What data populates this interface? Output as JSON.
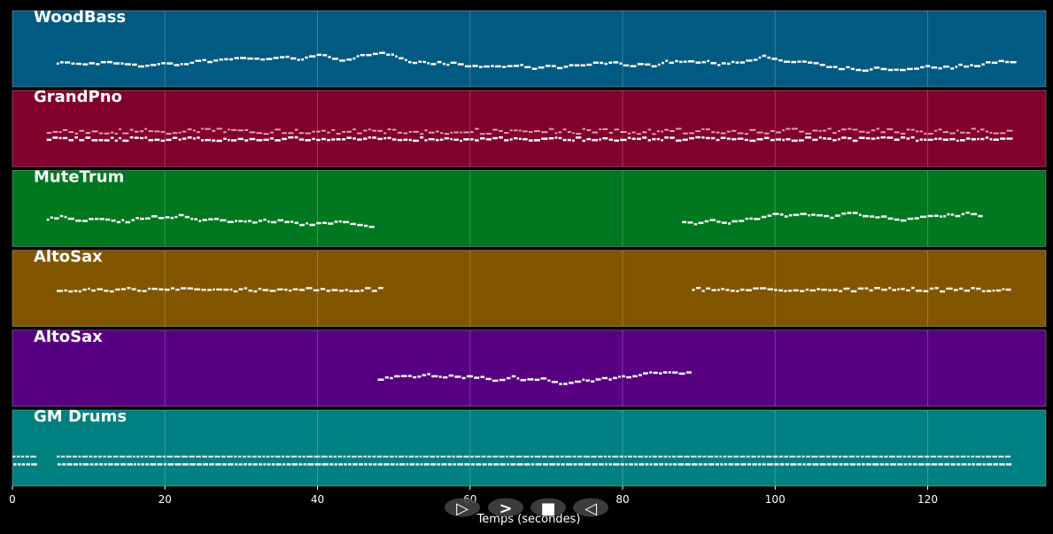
{
  "xlabel": "Temps (secondes)",
  "x_range": [
    0,
    135.5
  ],
  "x_ticks": [
    0,
    20,
    40,
    60,
    80,
    100,
    120
  ],
  "tracks": [
    {
      "name": "WoodBass",
      "color": "#005a82",
      "segments": [
        [
          5.8,
          130.8
        ]
      ],
      "style": "melody"
    },
    {
      "name": "GrandPno",
      "color": "#82002d",
      "segments": [
        [
          4.5,
          130.8
        ]
      ],
      "style": "chords"
    },
    {
      "name": "MuteTrum",
      "color": "#007820",
      "segments": [
        [
          4.5,
          47.0
        ],
        [
          87.8,
          127.2
        ]
      ],
      "style": "melody"
    },
    {
      "name": "AltoSax",
      "color": "#825600",
      "segments": [
        [
          5.8,
          48.3
        ],
        [
          89.1,
          130.8
        ]
      ],
      "style": "riff"
    },
    {
      "name": "AltoSax",
      "color": "#580082",
      "segments": [
        [
          47.9,
          88.5
        ]
      ],
      "style": "solo"
    },
    {
      "name": "GM Drums",
      "color": "#008080",
      "segments": [
        [
          0.0,
          2.5
        ],
        [
          5.8,
          130.8
        ]
      ],
      "style": "drums"
    }
  ],
  "controls": [
    {
      "name": "play-icon",
      "glyph": "▷"
    },
    {
      "name": "forward-icon",
      "glyph": ">"
    },
    {
      "name": "stop-icon",
      "glyph": "■"
    },
    {
      "name": "back-icon",
      "glyph": "◁"
    }
  ]
}
